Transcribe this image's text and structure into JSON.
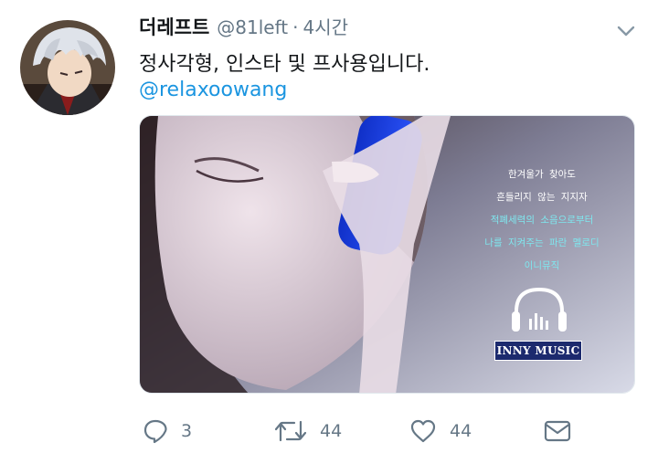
{
  "tweet": {
    "display_name": "더레프트",
    "handle": "@81left",
    "separator": "·",
    "time": "4시간",
    "text": "정사각형, 인스타 및 프사용입니다.",
    "mention": "@relaxoowang"
  },
  "media": {
    "lyrics": [
      {
        "text": "한겨울가 찾아도",
        "color": "#ffffff"
      },
      {
        "text": "흔들리지 않는 지지자",
        "color": "#ffffff"
      },
      {
        "text": "적폐세력의 소음으로부터",
        "color": "#7fe6ee"
      },
      {
        "text": "나를 지켜주는 파란 멜로디",
        "color": "#7fe6ee"
      },
      {
        "text": "이니뮤직",
        "color": "#7fe6ee"
      }
    ],
    "brand": "INNY MUSIC",
    "headphones_icon": "headphones-icon"
  },
  "actions": {
    "reply_count": "3",
    "retweet_count": "44",
    "like_count": "44"
  },
  "colors": {
    "text": "#14171a",
    "secondary": "#657786",
    "link": "#1b95e0"
  }
}
